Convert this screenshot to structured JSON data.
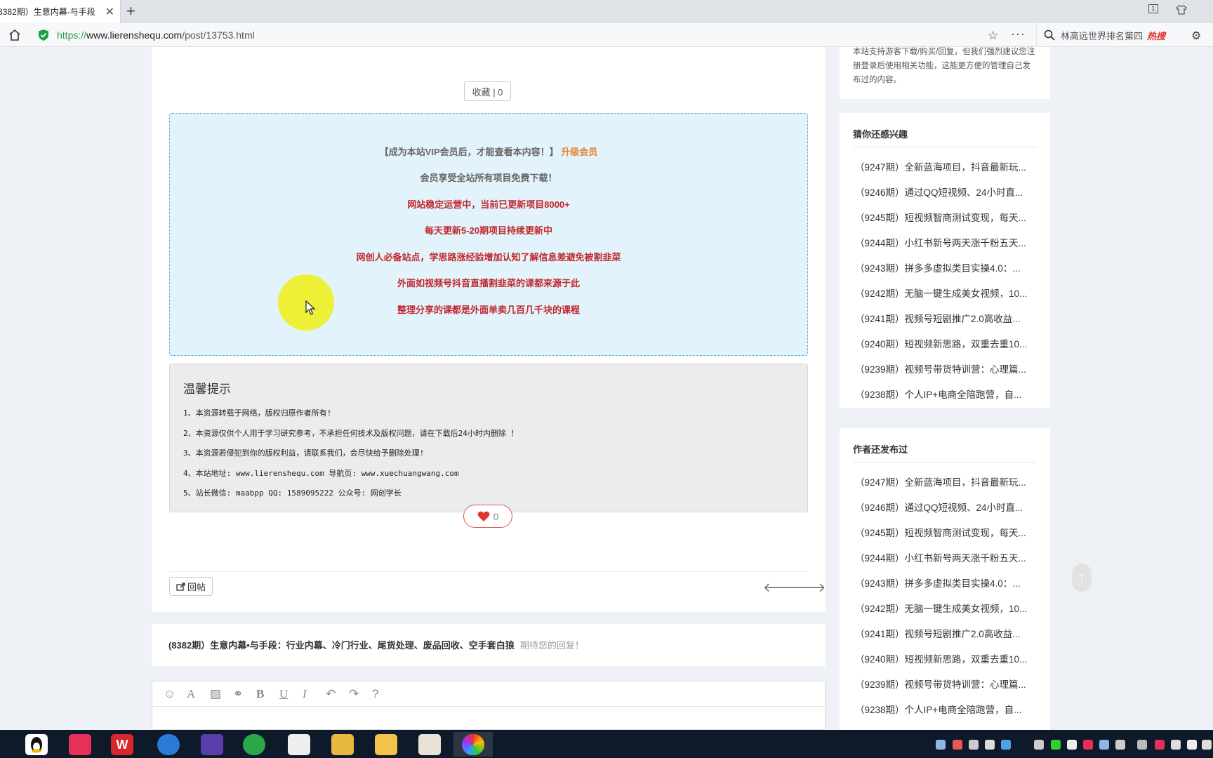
{
  "browser": {
    "tab_title": "8382期）生意内幕-与手段",
    "tab_close": "✕",
    "new_tab": "+",
    "tab_count": "1",
    "url_proto": "https://",
    "url_host": "www.lierenshequ.com",
    "url_path": "/post/13753.html",
    "search_text": "林高远世界排名第四",
    "search_hot": "热搜"
  },
  "post": {
    "fav_label": "收藏 | 0",
    "vip_lines": [
      "会员享受全站所有项目免费下载！",
      "网站稳定运营中，当前已更新项目8000+",
      "每天更新5-20期项目持续更新中",
      "网创人必备站点，学思路涨经验增加认知了解信息差避免被割韭菜",
      "外面如视频号抖音直播割韭菜的课都来源于此",
      "整理分享的课都是外面单卖几百几千块的课程"
    ],
    "vip_head": "【成为本站VIP会员后，才能查看本内容！】",
    "vip_upgrade": "升级会员",
    "tips_title": "温馨提示",
    "tips": [
      "1、本资源转载于网络，版权归原作者所有!",
      "2、本资源仅供个人用于学习研究参考，不承担任何技术及版权问题，请在下载后24小时内删除 ！",
      "3、本资源若侵犯到你的版权利益，请联系我们，会尽快给予删除处理!",
      "4、本站地址: www.lierenshequ.com 导航页: www.xuechuangwang.com",
      "5、站长微信: maabpp QQ: 1589095222 公众号: 网创学长"
    ],
    "like_count": "0",
    "reply_label": "回帖",
    "title": "(8382期）生意内幕•与手段：行业内幕、冷门行业、尾货处理、废品回收、空手套白狼",
    "reply_hint": "期待您的回复！"
  },
  "sidebar": {
    "top_text": "本站支持游客下载/购买/回复，但我们强烈建议您注册登录后使用相关功能，这能更方便的管理自己发布过的内容。",
    "section1_title": "猜你还感兴趣",
    "section2_title": "作者还发布过",
    "items": [
      "（9247期）全新蓝海项目，抖音最新玩...",
      "（9246期）通过QQ短视频、24小时直...",
      "（9245期）短视频智商测试变现，每天...",
      "（9244期）小红书新号两天涨千粉五天...",
      "（9243期）拼多多虚拟类目实操4.0：...",
      "（9242期）无脑一键生成美女视频，10...",
      "（9241期）视频号短剧推广2.0高收益...",
      "（9240期）短视频新思路，双重去重10...",
      "（9239期）视频号带货特训营：心理篇...",
      "（9238期）个人IP+电商全陪跑营，自..."
    ],
    "back_top": "↑"
  },
  "colors": {
    "vip_red": "#c0282d",
    "upgrade_orange": "#e8832a",
    "vip_bg": "#e3f3fb",
    "secure_green": "#1f9e46"
  }
}
